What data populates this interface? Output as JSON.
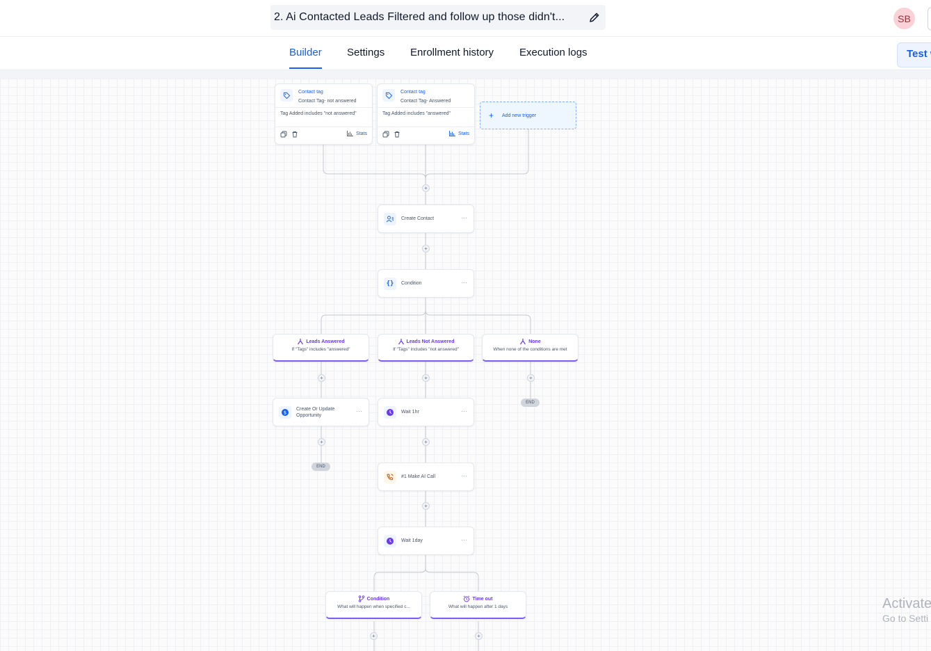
{
  "header": {
    "workflow_title": "2. Ai Contacted Leads Filtered and follow up those didn't...",
    "edit_icon": "pencil-icon",
    "avatar_initials": "SB"
  },
  "tabs": [
    {
      "label": "Builder",
      "active": true
    },
    {
      "label": "Settings",
      "active": false
    },
    {
      "label": "Enrollment history",
      "active": false
    },
    {
      "label": "Execution logs",
      "active": false
    }
  ],
  "test_button_label": "Test w",
  "triggers": [
    {
      "title": "Contact tag",
      "subtitle": "Contact Tag- not answered",
      "condition": "Tag Added includes \"not answered\"",
      "stats_label": "Stats"
    },
    {
      "title": "Contact tag",
      "subtitle": "Contact Tag- Answered",
      "condition": "Tag Added includes \"answered\"",
      "stats_label": "Stats"
    }
  ],
  "add_trigger_label": "Add new trigger",
  "actions": {
    "create_contact": "Create Contact",
    "condition": "Condition",
    "create_opportunity": "Create Or Update Opportunity",
    "wait_1hr": "Wait 1hr",
    "ai_call": "#1 Make AI Call",
    "wait_1day": "Wait 1day"
  },
  "branches": [
    {
      "title": "Leads Answered",
      "subtitle": "If \"Tags\" includes \"answered\""
    },
    {
      "title": "Leads Not Answered",
      "subtitle": "If \"Tags\" includes \"not answered\""
    },
    {
      "title": "None",
      "subtitle": "When none of the conditions are met"
    }
  ],
  "wait_branches": [
    {
      "title": "Condition",
      "subtitle": "What will happen when specified c..."
    },
    {
      "title": "Time out",
      "subtitle": "What will happen after 1 days"
    }
  ],
  "end_label": "END",
  "plus_label": "+",
  "more_label": "···",
  "watermark": {
    "line1": "Activate",
    "line2": "Go to Setti"
  },
  "colors": {
    "accent": "#155eef",
    "branch": "#6938ef",
    "avatar_bg": "#fbd1d8"
  }
}
